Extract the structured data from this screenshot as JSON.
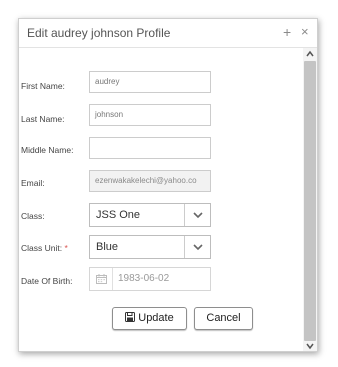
{
  "dialog": {
    "title": "Edit audrey johnson Profile",
    "plus_symbol": "+",
    "close_symbol": "×"
  },
  "form": {
    "first_name": {
      "label": "First Name:",
      "value": "audrey"
    },
    "last_name": {
      "label": "Last Name:",
      "value": "johnson"
    },
    "middle_name": {
      "label": "Middle Name:",
      "value": ""
    },
    "email": {
      "label": "Email:",
      "value": "ezenwakakelechi@yahoo.co"
    },
    "class": {
      "label": "Class:",
      "value": "JSS One"
    },
    "class_unit": {
      "label": "Class Unit:",
      "required_mark": "*",
      "value": "Blue"
    },
    "date_of_birth": {
      "label": "Date Of Birth:",
      "value": "1983-06-02"
    }
  },
  "buttons": {
    "update_label": "Update",
    "cancel_label": "Cancel"
  },
  "icons": {
    "chevron": "chevron-down-icon",
    "calendar": "calendar-icon",
    "save": "floppy-disk-icon"
  }
}
